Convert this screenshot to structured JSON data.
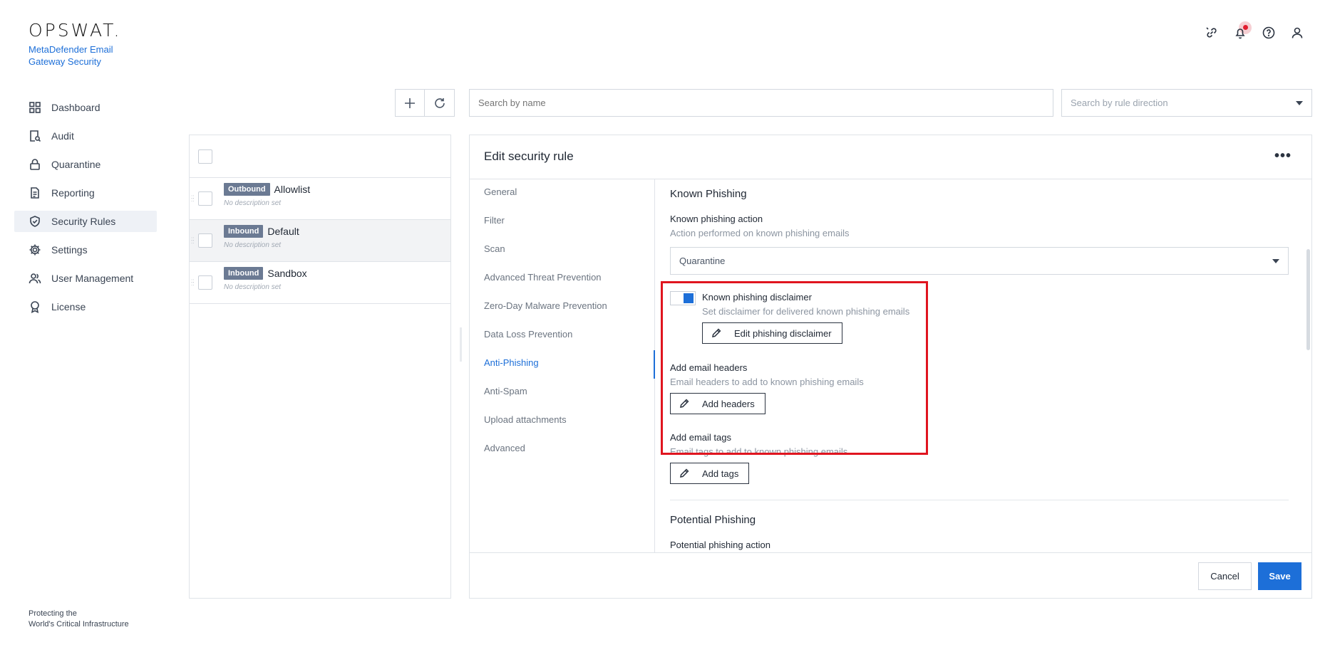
{
  "brand": {
    "logo_text": "OPSWAT.",
    "product_name": "MetaDefender Email Gateway Security",
    "footer_line1": "Protecting the",
    "footer_line2": "World's Critical Infrastructure"
  },
  "sidebar": {
    "items": [
      {
        "label": "Dashboard",
        "icon": "dashboard-icon"
      },
      {
        "label": "Audit",
        "icon": "audit-icon"
      },
      {
        "label": "Quarantine",
        "icon": "lock-icon"
      },
      {
        "label": "Reporting",
        "icon": "document-icon"
      },
      {
        "label": "Security Rules",
        "icon": "shield-check-icon",
        "active": true
      },
      {
        "label": "Settings",
        "icon": "gear-icon"
      },
      {
        "label": "User Management",
        "icon": "users-icon"
      },
      {
        "label": "License",
        "icon": "badge-icon"
      }
    ]
  },
  "header_icons": [
    "link-icon",
    "bell-icon",
    "help-icon",
    "user-icon"
  ],
  "toolbar": {
    "search_name_placeholder": "Search by name",
    "search_direction_placeholder": "Search by rule direction"
  },
  "rules": [
    {
      "direction": "Outbound",
      "name": "Allowlist",
      "description": "No description set"
    },
    {
      "direction": "Inbound",
      "name": "Default",
      "description": "No description set"
    },
    {
      "direction": "Inbound",
      "name": "Sandbox",
      "description": "No description set"
    }
  ],
  "edit": {
    "title": "Edit security rule",
    "more": "•••",
    "tabs": [
      "General",
      "Filter",
      "Scan",
      "Advanced Threat Prevention",
      "Zero-Day Malware Prevention",
      "Data Loss Prevention",
      "Anti-Phishing",
      "Anti-Spam",
      "Upload attachments",
      "Advanced"
    ],
    "active_tab": "Anti-Phishing",
    "known_phishing": {
      "section_title": "Known Phishing",
      "action_label": "Known phishing action",
      "action_help": "Action performed on known phishing emails",
      "action_value": "Quarantine",
      "disclaimer_label": "Known phishing disclaimer",
      "disclaimer_help": "Set disclaimer for delivered known phishing emails",
      "disclaimer_enabled": true,
      "edit_disclaimer_button": "Edit phishing disclaimer",
      "headers_label": "Add email headers",
      "headers_help": "Email headers to add to known phishing emails",
      "headers_button": "Add headers",
      "tags_label": "Add email tags",
      "tags_help": "Email tags to add to known phishing emails",
      "tags_button": "Add tags"
    },
    "potential_phishing": {
      "section_title": "Potential Phishing",
      "action_label": "Potential phishing action"
    },
    "cancel_label": "Cancel",
    "save_label": "Save"
  },
  "colors": {
    "accent": "#1d6fd8",
    "highlight": "#e0151f",
    "badge": "#6b7a93"
  }
}
